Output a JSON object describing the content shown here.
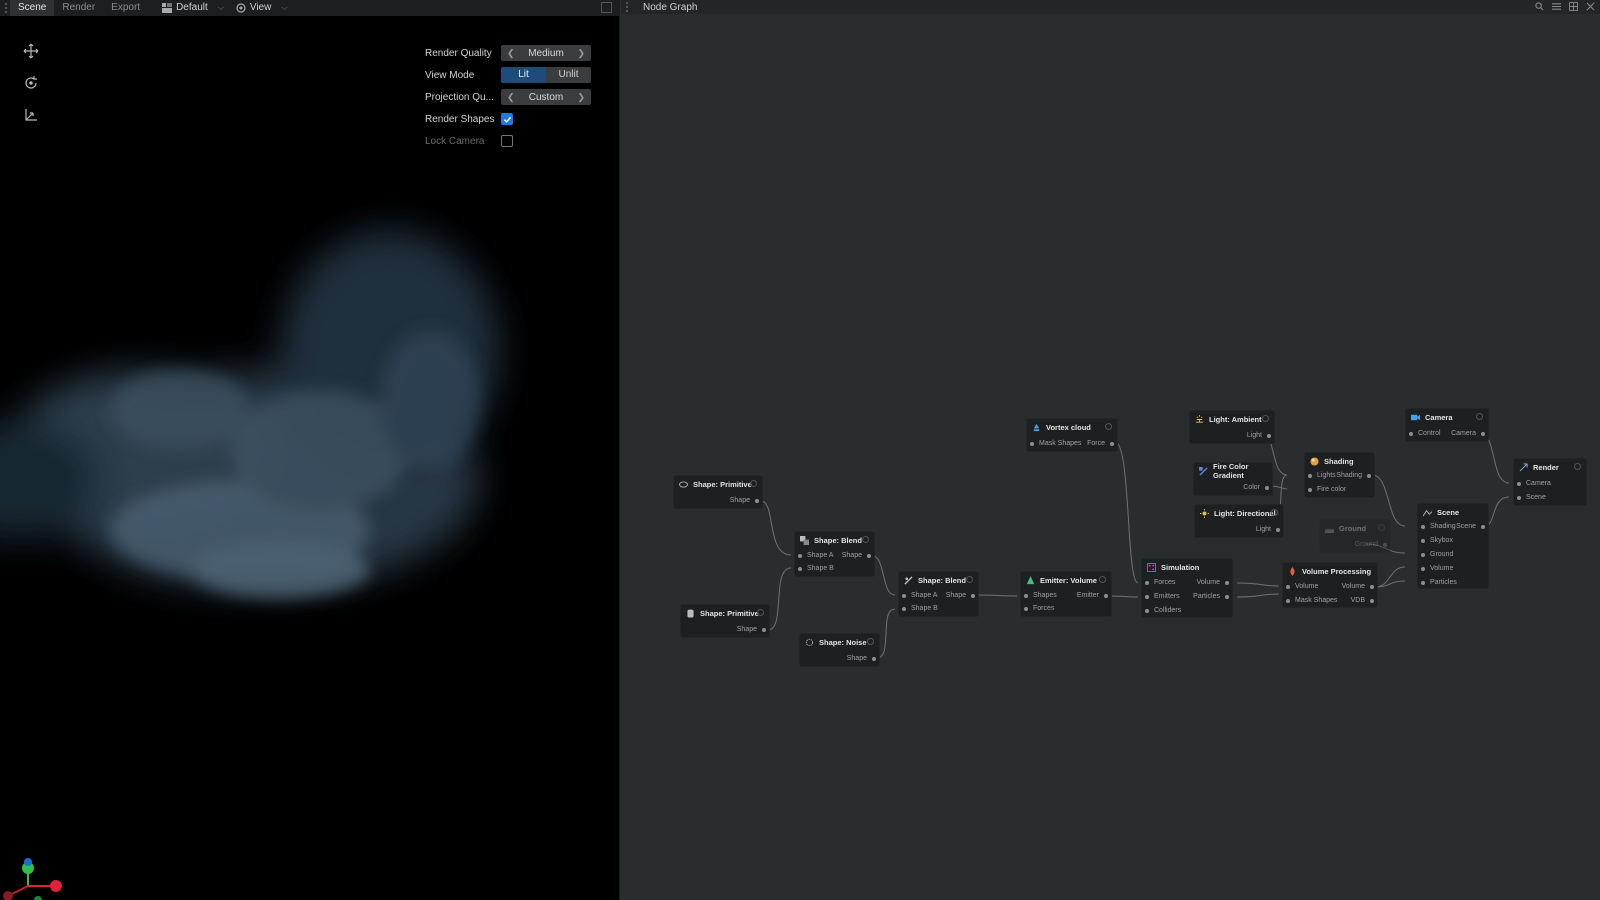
{
  "viewport": {
    "tabs": [
      {
        "label": "Scene",
        "active": true
      },
      {
        "label": "Render",
        "active": false
      },
      {
        "label": "Export",
        "active": false
      }
    ],
    "layout_dropdown": "Default",
    "view_dropdown": "View",
    "tools": [
      "move-icon",
      "rotate-icon",
      "axes-icon"
    ],
    "properties": {
      "render_quality": {
        "label": "Render Quality",
        "value": "Medium"
      },
      "view_mode": {
        "label": "View Mode",
        "options": [
          "Lit",
          "Unlit"
        ],
        "selected": "Lit"
      },
      "projection_quality": {
        "label": "Projection Qu...",
        "value": "Custom"
      },
      "render_shapes": {
        "label": "Render Shapes",
        "checked": true
      },
      "lock_camera": {
        "label": "Lock Camera",
        "checked": false
      }
    }
  },
  "graph": {
    "title": "Node Graph",
    "accent": "#1f7ae0",
    "nodes": {
      "shape_primitive_1": {
        "title": "Shape: Primitive",
        "outputs": [
          "Shape"
        ]
      },
      "shape_primitive_2": {
        "title": "Shape: Primitive",
        "outputs": [
          "Shape"
        ]
      },
      "shape_blend_1": {
        "title": "Shape: Blend",
        "inputs": [
          "Shape A",
          "Shape B"
        ],
        "outputs": [
          "Shape"
        ]
      },
      "shape_noise": {
        "title": "Shape: Noise",
        "outputs": [
          "Shape"
        ]
      },
      "shape_blend_2": {
        "title": "Shape: Blend",
        "inputs": [
          "Shape A",
          "Shape B"
        ],
        "outputs": [
          "Shape"
        ]
      },
      "emitter_volume": {
        "title": "Emitter: Volume",
        "inputs": [
          "Shapes",
          "Forces"
        ],
        "outputs": [
          "Emitter"
        ]
      },
      "vortex_cloud": {
        "title": "Vortex cloud",
        "inputs": [
          "Mask Shapes"
        ],
        "outputs": [
          "Force"
        ]
      },
      "simulation": {
        "title": "Simulation",
        "inputs": [
          "Forces",
          "Emitters",
          "Colliders"
        ],
        "outputs": [
          "Volume",
          "Particles"
        ]
      },
      "light_ambient": {
        "title": "Light: Ambient",
        "outputs": [
          "Light"
        ]
      },
      "fire_color_gradient": {
        "title": "Fire Color Gradient",
        "outputs": [
          "Color"
        ]
      },
      "light_directional": {
        "title": "Light: Directional",
        "outputs": [
          "Light"
        ]
      },
      "shading": {
        "title": "Shading",
        "inputs": [
          "Lights",
          "Fire color"
        ],
        "outputs": [
          "Shading"
        ]
      },
      "ground": {
        "title": "Ground",
        "outputs": [
          "Ground"
        ]
      },
      "volume_processing": {
        "title": "Volume Processing",
        "inputs": [
          "Volume",
          "Mask Shapes"
        ],
        "outputs": [
          "Volume",
          "VDB"
        ]
      },
      "camera": {
        "title": "Camera",
        "inputs": [
          "Control"
        ],
        "outputs": [
          "Camera"
        ]
      },
      "scene": {
        "title": "Scene",
        "inputs": [
          "Shading",
          "Skybox",
          "Ground",
          "Volume",
          "Particles"
        ],
        "outputs": [
          "Scene"
        ]
      },
      "render": {
        "title": "Render",
        "inputs": [
          "Camera",
          "Scene"
        ]
      }
    }
  }
}
